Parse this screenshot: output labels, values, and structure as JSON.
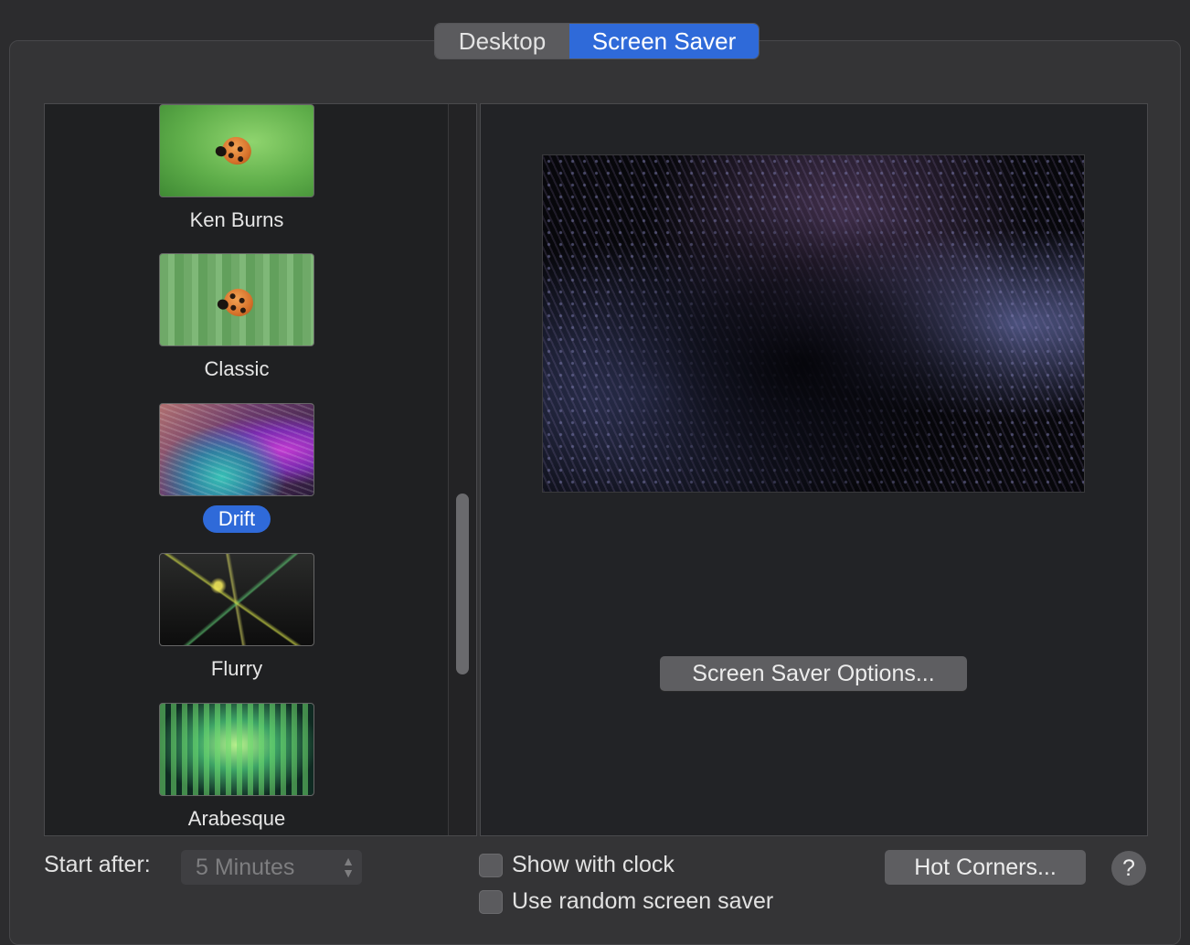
{
  "tabs": [
    {
      "label": "Desktop",
      "selected": false
    },
    {
      "label": "Screen Saver",
      "selected": true
    }
  ],
  "savers": [
    {
      "label": "Ken Burns",
      "selected": false
    },
    {
      "label": "Classic",
      "selected": false
    },
    {
      "label": "Drift",
      "selected": true
    },
    {
      "label": "Flurry",
      "selected": false
    },
    {
      "label": "Arabesque",
      "selected": false
    }
  ],
  "preview": {
    "options_label": "Screen Saver Options..."
  },
  "footer": {
    "start_after_label": "Start after:",
    "start_after_value": "5 Minutes",
    "show_clock_label": "Show with clock",
    "show_clock_checked": false,
    "random_label": "Use random screen saver",
    "random_checked": false,
    "hot_corners_label": "Hot Corners...",
    "help_label": "?"
  },
  "colors": {
    "accent": "#2f6ad9",
    "background": "#2c2c2e"
  }
}
